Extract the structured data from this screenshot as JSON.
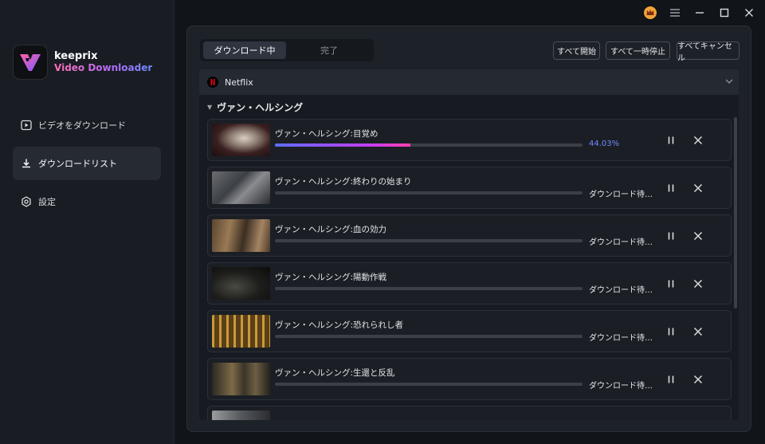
{
  "app": {
    "name": "keeprix",
    "subtitle": "Video Downloader"
  },
  "sidebar": {
    "items": [
      {
        "label": "ビデオをダウンロード",
        "icon": "play-square-icon",
        "active": false
      },
      {
        "label": "ダウンロードリスト",
        "icon": "download-icon",
        "active": true
      },
      {
        "label": "設定",
        "icon": "gear-icon",
        "active": false
      }
    ]
  },
  "titlebar": {
    "icons": [
      "crown-icon",
      "menu-icon",
      "minimize-icon",
      "maximize-icon",
      "close-icon"
    ]
  },
  "tabs": {
    "downloading": "ダウンロード中",
    "completed": "完了"
  },
  "toolbar": {
    "start_all": "すべて開始",
    "pause_all": "すべて一時停止",
    "cancel_all": "すべてキャンセル"
  },
  "group": {
    "service": "Netflix",
    "season": "ヴァン・ヘルシング"
  },
  "episodes": [
    {
      "title": "ヴァン・ヘルシング:目覚め",
      "status": "44.03%",
      "progress": 0.4403,
      "state": "downloading"
    },
    {
      "title": "ヴァン・ヘルシング:終わりの始まり",
      "status": "ダウンロード待ち...",
      "progress": 0,
      "state": "waiting"
    },
    {
      "title": "ヴァン・ヘルシング:血の効力",
      "status": "ダウンロード待ち...",
      "progress": 0,
      "state": "waiting"
    },
    {
      "title": "ヴァン・ヘルシング:陽動作戦",
      "status": "ダウンロード待ち...",
      "progress": 0,
      "state": "waiting"
    },
    {
      "title": "ヴァン・ヘルシング:恐れられし者",
      "status": "ダウンロード待ち...",
      "progress": 0,
      "state": "waiting"
    },
    {
      "title": "ヴァン・ヘルシング:生還と反乱",
      "status": "ダウンロード待ち...",
      "progress": 0,
      "state": "waiting"
    }
  ],
  "colors": {
    "accent": "#6f8bff",
    "progress_start": "#5d6dff",
    "progress_end": "#ff3fb0",
    "netflix": "#e50914"
  }
}
